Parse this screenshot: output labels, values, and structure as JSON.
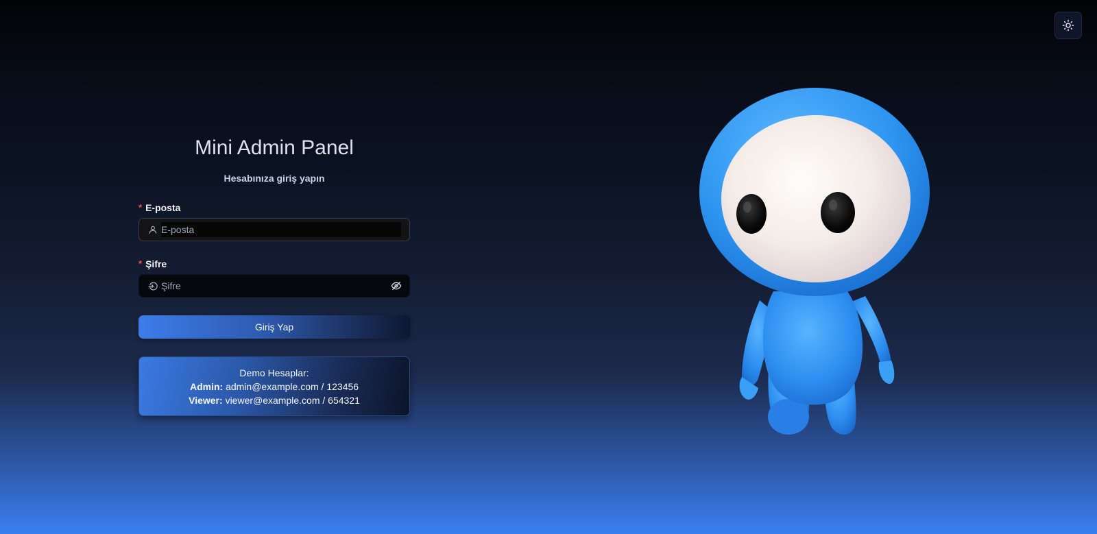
{
  "theme_toggle": {
    "icon": "sun-icon"
  },
  "login": {
    "title": "Mini Admin Panel",
    "subtitle": "Hesabınıza giriş yapın",
    "email": {
      "label": "E-posta",
      "required_mark": "*",
      "placeholder": "E-posta",
      "value": "",
      "icon": "user-icon"
    },
    "password": {
      "label": "Şifre",
      "required_mark": "*",
      "placeholder": "Şifre",
      "value": "",
      "icon": "login-icon",
      "toggle_icon": "eye-off-icon"
    },
    "submit_label": "Giriş Yap"
  },
  "demo": {
    "heading": "Demo Hesaplar:",
    "accounts": [
      {
        "role": "Admin:",
        "credentials": "admin@example.com / 123456"
      },
      {
        "role": "Viewer:",
        "credentials": "viewer@example.com / 654321"
      }
    ]
  },
  "colors": {
    "required": "#ff4d4f",
    "accent": "#3d7de9",
    "mascot_blue": "#2f95f2"
  }
}
